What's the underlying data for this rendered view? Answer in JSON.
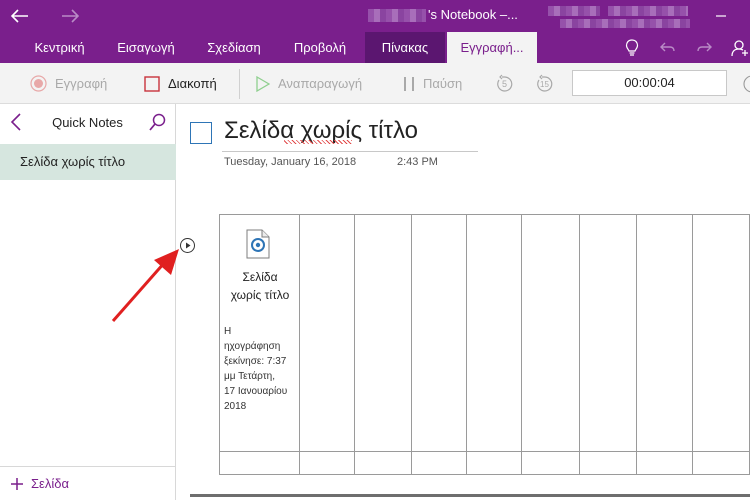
{
  "titlebar": {
    "title": "'s Notebook –..."
  },
  "tabs": [
    {
      "label": "Κεντρική"
    },
    {
      "label": "Εισαγωγή"
    },
    {
      "label": "Σχεδίαση"
    },
    {
      "label": "Προβολή"
    },
    {
      "label": "Πίνακας"
    },
    {
      "label": "Εγγραφή..."
    }
  ],
  "commandbar": {
    "record_label": "Εγγραφή",
    "stop_label": "Διακοπή",
    "play_label": "Αναπαραγωγή",
    "pause_label": "Παύση",
    "rewind_label": "5",
    "forward_label": "15",
    "timer": "00:00:04"
  },
  "sidebar": {
    "section_title": "Quick Notes",
    "pages": [
      {
        "label": "Σελίδα χωρίς τίτλο"
      }
    ],
    "add_page_label": "Σελίδα"
  },
  "page": {
    "title": "Σελίδα χωρίς τίτλο",
    "date": "Tuesday, January 16, 2018",
    "time": "2:43 PM"
  },
  "recording": {
    "name_line1": "Σελίδα",
    "name_line2": "χωρίς τίτλο",
    "meta_lines": [
      "Η",
      "ηχογράφηση",
      "ξεκίνησε: 7:37",
      "μμ Τετάρτη,",
      "17 Ιανουαρίου",
      "2018"
    ]
  },
  "colors": {
    "accent": "#7a1f8c",
    "selected_page": "#d6e6df",
    "annotation_arrow": "#e02020"
  }
}
